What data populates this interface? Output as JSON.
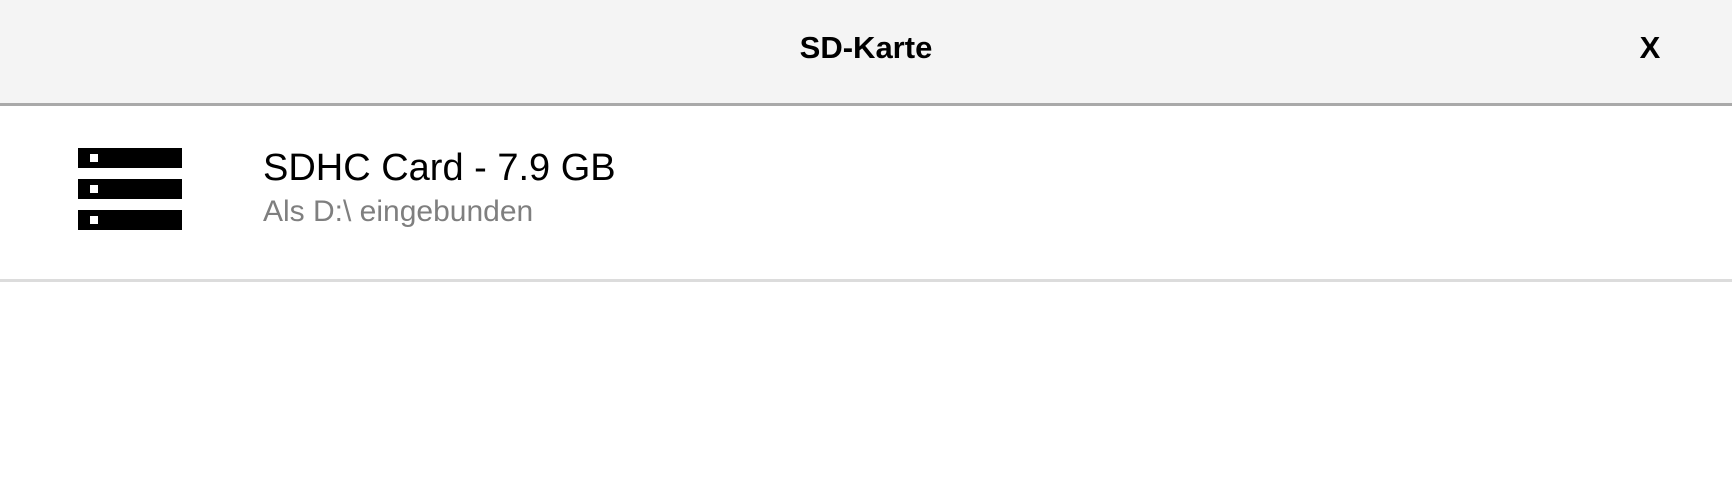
{
  "header": {
    "title": "SD-Karte",
    "close_label": "X"
  },
  "drives": [
    {
      "icon": "storage-drive-icon",
      "title": "SDHC Card - 7.9 GB",
      "subtitle": "Als D:\\ eingebunden"
    }
  ],
  "colors": {
    "header_background": "#f4f4f4",
    "header_border": "#a9a9a9",
    "separator": "#dcdcdc",
    "subtitle_text": "#7f7f7f"
  }
}
